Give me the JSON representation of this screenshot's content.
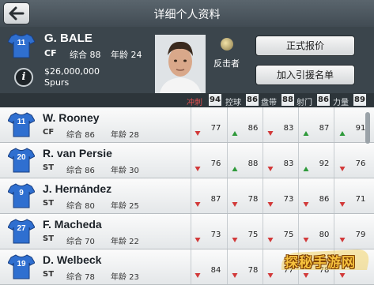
{
  "header": {
    "title": "详细个人资料"
  },
  "profile": {
    "number": "11",
    "name": "G. BALE",
    "position": "CF",
    "rating_label": "综合 88",
    "age_label": "年龄 24",
    "value": "$26,000,000",
    "club": "Spurs",
    "skill_label": "反击者",
    "offer_button": "正式报价",
    "shortlist_button": "加入引援名单"
  },
  "stats_header": {
    "pace_label": "冲刺",
    "pace_value": "94",
    "control_label": "控球",
    "control_value": "86",
    "dribble_label": "盘带",
    "dribble_value": "88",
    "shoot_label": "射门",
    "shoot_value": "86",
    "power_label": "力量",
    "power_value": "89"
  },
  "players": [
    {
      "number": "11",
      "name": "W. Rooney",
      "position": "CF",
      "rating": "综合 86",
      "age": "年龄 28",
      "stats": [
        "77",
        "86",
        "83",
        "87",
        "91"
      ],
      "trend": [
        "down",
        "up",
        "down",
        "up",
        "up"
      ]
    },
    {
      "number": "20",
      "name": "R. van Persie",
      "position": "ST",
      "rating": "综合 86",
      "age": "年龄 30",
      "stats": [
        "76",
        "88",
        "83",
        "92",
        "76"
      ],
      "trend": [
        "down",
        "up",
        "down",
        "up",
        "down"
      ]
    },
    {
      "number": "9",
      "name": "J. Hernández",
      "position": "ST",
      "rating": "综合 80",
      "age": "年龄 25",
      "stats": [
        "87",
        "78",
        "73",
        "86",
        "71"
      ],
      "trend": [
        "down",
        "down",
        "down",
        "down",
        "down"
      ]
    },
    {
      "number": "27",
      "name": "F. Macheda",
      "position": "ST",
      "rating": "综合 70",
      "age": "年龄 22",
      "stats": [
        "73",
        "75",
        "75",
        "80",
        "79"
      ],
      "trend": [
        "down",
        "down",
        "down",
        "down",
        "down"
      ]
    },
    {
      "number": "19",
      "name": "D. Welbeck",
      "position": "ST",
      "rating": "综合 78",
      "age": "年龄 23",
      "stats": [
        "84",
        "78",
        "77",
        "78",
        ""
      ],
      "trend": [
        "down",
        "down",
        "down",
        "down",
        "down"
      ]
    }
  ],
  "watermark": "探秘手游网",
  "colors": {
    "shirt": "#2f6fd0",
    "arrow_up": "#2e9a3a",
    "arrow_down": "#d23a3a",
    "pace_label": "#e05050"
  }
}
